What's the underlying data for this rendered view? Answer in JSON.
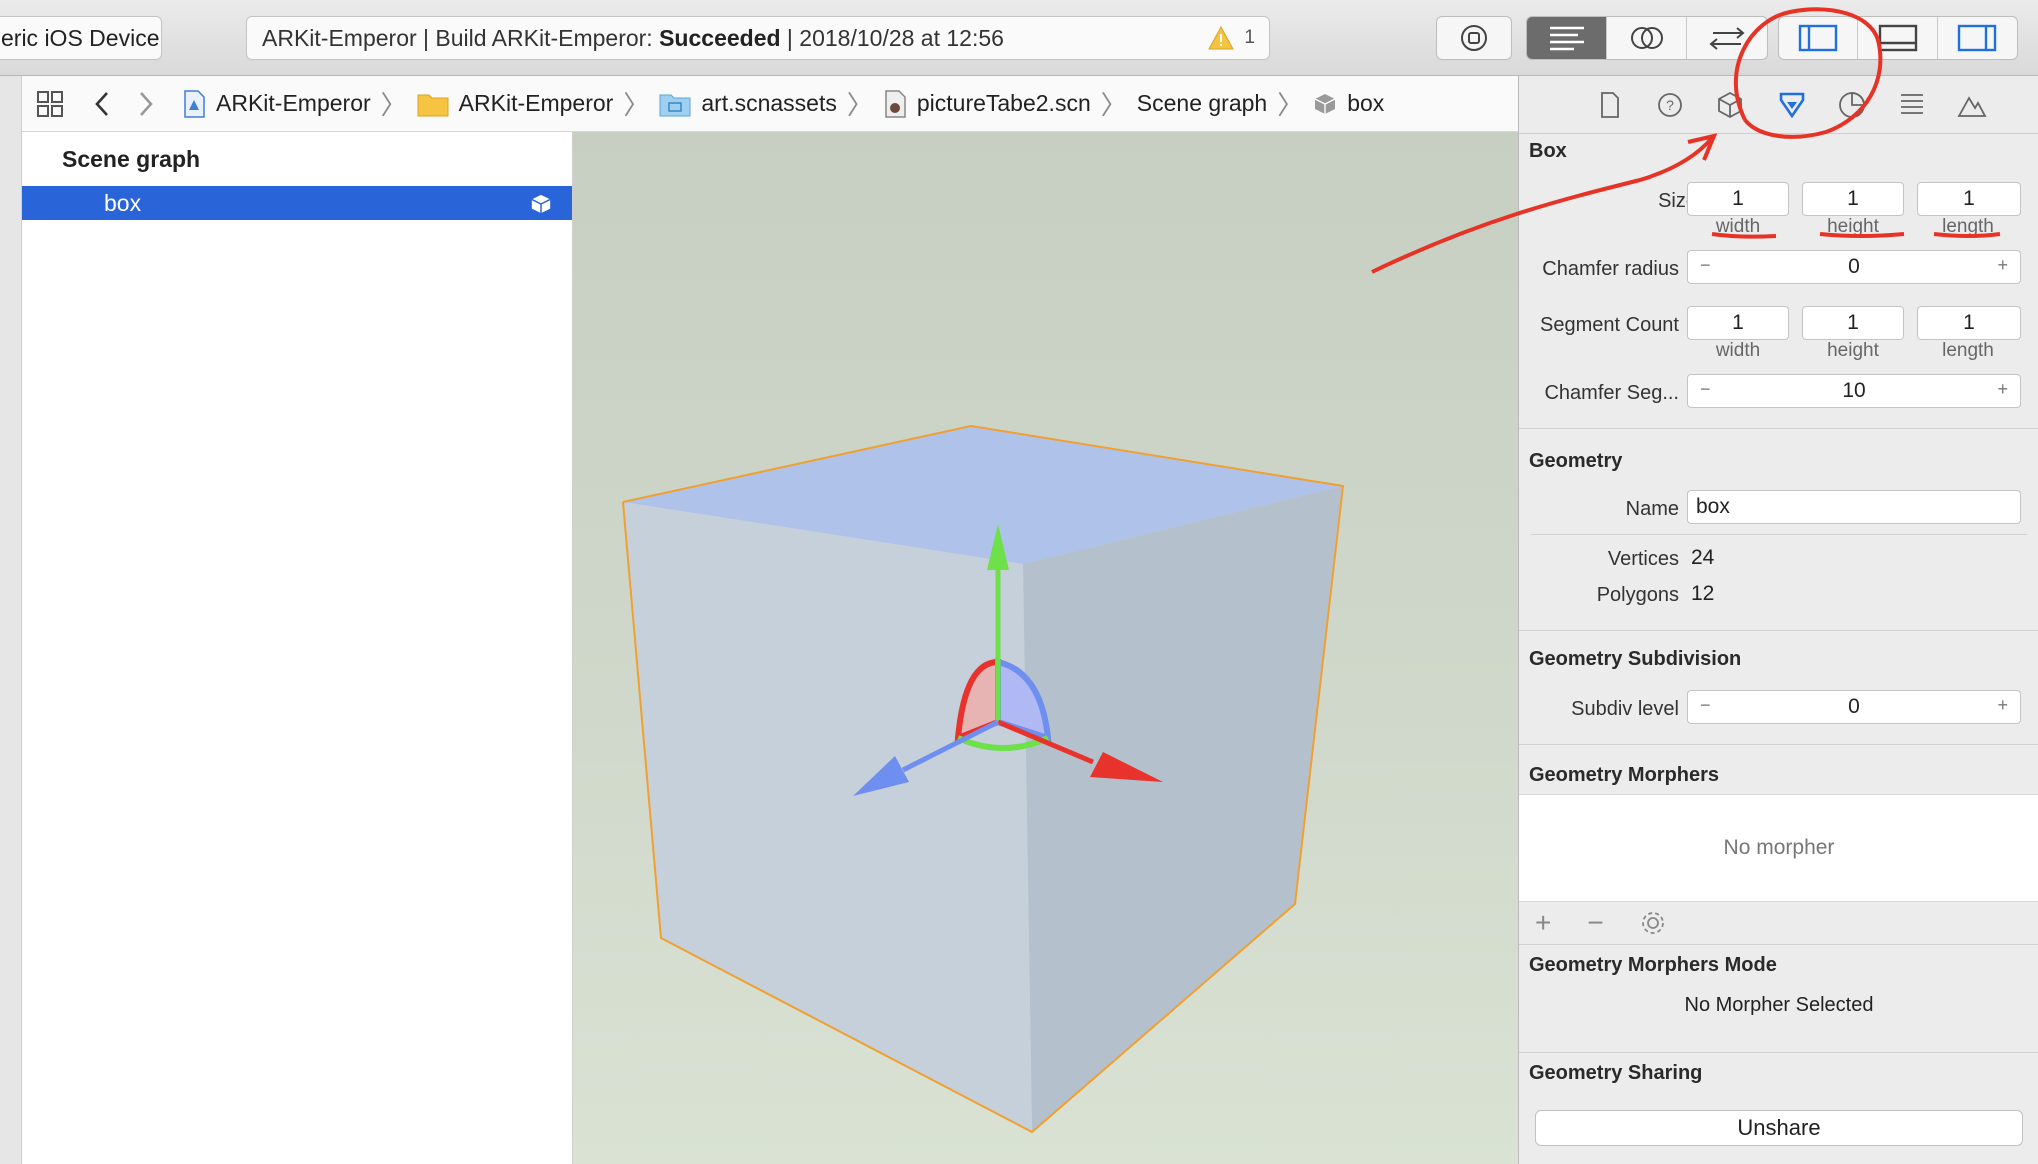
{
  "toolbar": {
    "scheme_device": "eric iOS Device",
    "activity_prefix": "ARKit-Emperor | Build ARKit-Emperor: ",
    "activity_status": "Succeeded",
    "activity_suffix": " | 2018/10/28 at 12:56",
    "warning_count": "1"
  },
  "jumpbar": {
    "crumbs": [
      "ARKit-Emperor",
      "ARKit-Emperor",
      "art.scnassets",
      "pictureTabe2.scn",
      "Scene graph",
      "box"
    ]
  },
  "outline": {
    "title": "Scene graph",
    "selected_node": "box"
  },
  "inspector": {
    "box_section": {
      "title": "Box",
      "size_label": "Size",
      "size_values": [
        "1",
        "1",
        "1"
      ],
      "size_sublabels": [
        "width",
        "height",
        "length"
      ],
      "chamfer_radius_label": "Chamfer radius",
      "chamfer_radius_value": "0",
      "segment_count_label": "Segment Count",
      "segment_values": [
        "1",
        "1",
        "1"
      ],
      "segment_sublabels": [
        "width",
        "height",
        "length"
      ],
      "chamfer_seg_label": "Chamfer Seg...",
      "chamfer_seg_value": "10"
    },
    "geometry": {
      "title": "Geometry",
      "name_label": "Name",
      "name_value": "box",
      "vertices_label": "Vertices",
      "vertices_value": "24",
      "polygons_label": "Polygons",
      "polygons_value": "12"
    },
    "subdivision": {
      "title": "Geometry Subdivision",
      "subdiv_label": "Subdiv level",
      "subdiv_value": "0"
    },
    "morphers": {
      "title": "Geometry Morphers",
      "empty_text": "No morpher"
    },
    "morphers_mode": {
      "title": "Geometry Morphers Mode",
      "status": "No Morpher Selected"
    },
    "sharing": {
      "title": "Geometry Sharing",
      "button": "Unshare"
    }
  },
  "colors": {
    "accent": "#2a64d9",
    "annotation": "#e63325",
    "selection_outline": "#f0a030",
    "axis_x": "#e8322c",
    "axis_y": "#6ee04a",
    "axis_z": "#6f8ff0"
  }
}
